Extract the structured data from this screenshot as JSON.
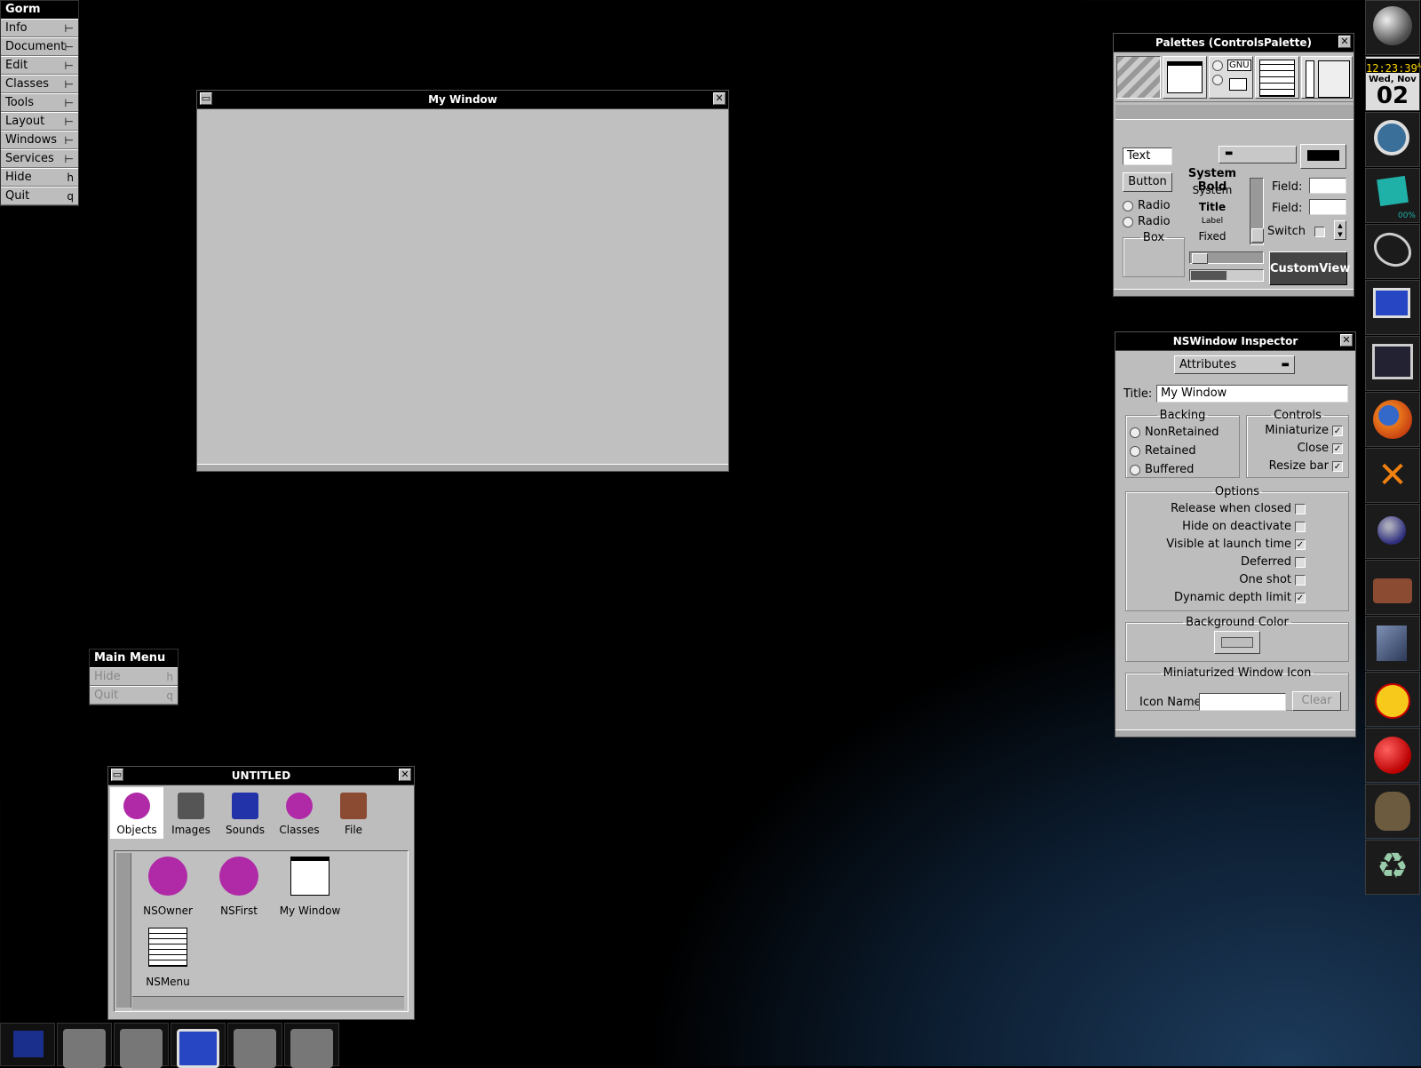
{
  "app_menu": {
    "title": "Gorm",
    "items": [
      {
        "label": "Info",
        "key": "⊢"
      },
      {
        "label": "Document",
        "key": "⊢"
      },
      {
        "label": "Edit",
        "key": "⊢"
      },
      {
        "label": "Classes",
        "key": "⊢"
      },
      {
        "label": "Tools",
        "key": "⊢"
      },
      {
        "label": "Layout",
        "key": "⊢"
      },
      {
        "label": "Windows",
        "key": "⊢"
      },
      {
        "label": "Services",
        "key": "⊢"
      },
      {
        "label": "Hide",
        "key": "h"
      },
      {
        "label": "Quit",
        "key": "q"
      }
    ]
  },
  "my_window": {
    "title": "My Window"
  },
  "main_menu": {
    "title": "Main Menu",
    "items": [
      {
        "label": "Hide",
        "key": "h"
      },
      {
        "label": "Quit",
        "key": "q"
      }
    ]
  },
  "untitled": {
    "title": "UNTITLED",
    "tabs": [
      "Objects",
      "Images",
      "Sounds",
      "Classes",
      "File"
    ],
    "objects": [
      "NSOwner",
      "NSFirst",
      "My Window",
      "NSMenu"
    ]
  },
  "palettes": {
    "title": "Palettes (ControlsPalette)",
    "text_field": "Text",
    "button": "Button",
    "radio1": "Radio",
    "radio2": "Radio",
    "box": "Box",
    "fonts": [
      "System Bold",
      "System",
      "Title",
      "Label",
      "Fixed"
    ],
    "field1": "Field:",
    "field2": "Field:",
    "switch": "Switch",
    "custom_view": "CustomView",
    "gnu": "GNU"
  },
  "inspector": {
    "title": "NSWindow Inspector",
    "mode": "Attributes",
    "title_label": "Title:",
    "title_value": "My Window",
    "backing": {
      "legend": "Backing",
      "options": [
        "NonRetained",
        "Retained",
        "Buffered"
      ]
    },
    "controls": {
      "legend": "Controls",
      "items": [
        {
          "label": "Miniaturize",
          "checked": true
        },
        {
          "label": "Close",
          "checked": true
        },
        {
          "label": "Resize bar",
          "checked": true
        }
      ]
    },
    "options": {
      "legend": "Options",
      "items": [
        {
          "label": "Release when closed",
          "checked": false
        },
        {
          "label": "Hide on deactivate",
          "checked": false
        },
        {
          "label": "Visible at launch time",
          "checked": true
        },
        {
          "label": "Deferred",
          "checked": false
        },
        {
          "label": "One shot",
          "checked": false
        },
        {
          "label": "Dynamic depth limit",
          "checked": true
        }
      ]
    },
    "bg_color_legend": "Background Color",
    "mini_icon_legend": "Miniaturized Window Icon",
    "icon_name_label": "Icon Name",
    "clear_button": "Clear"
  },
  "clock": {
    "time": "12:23:39",
    "ampm": "A",
    "day": "Wed, Nov",
    "date": "02"
  },
  "dock_percent": "00%",
  "check_mark": "✓",
  "colors": {
    "background": "#000000",
    "panel": "#bdbdbd",
    "titlebar": "#000000",
    "clock_text": "#ffd800",
    "desktop_glow": "#1d3b5c"
  }
}
